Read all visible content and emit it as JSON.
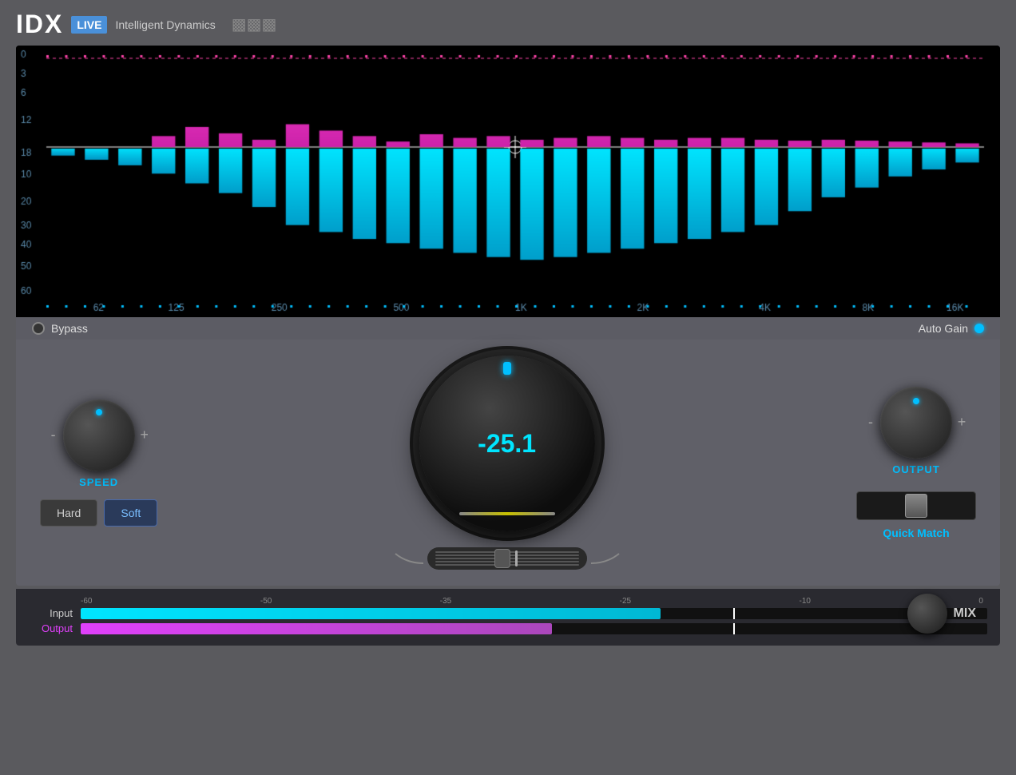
{
  "header": {
    "logo": "IDX",
    "live_badge": "LIVE",
    "subtitle": "Intelligent Dynamics",
    "bars_icon": "||||''"
  },
  "bypass": {
    "label": "Bypass"
  },
  "autogain": {
    "label": "Auto Gain"
  },
  "speed_knob": {
    "label": "SPEED",
    "minus": "-",
    "plus": "+"
  },
  "center_knob": {
    "value": "-25.1"
  },
  "output_knob": {
    "label": "OUTPUT",
    "minus": "-",
    "plus": "+"
  },
  "presets": {
    "hard_label": "Hard",
    "soft_label": "Soft"
  },
  "quick_match": {
    "label": "Quick Match"
  },
  "meters": {
    "input_label": "Input",
    "output_label": "Output",
    "scale": [
      "-60",
      "-50",
      "-35",
      "-25",
      "-10",
      "0"
    ],
    "input_fill_percent": 64,
    "output_fill_percent": 52
  },
  "mix": {
    "label": "MIX"
  },
  "spectrum": {
    "left_labels": [
      "0",
      "3",
      "6",
      "12",
      "18",
      "10",
      "20",
      "30",
      "40",
      "50",
      "60"
    ],
    "bottom_labels": [
      "62",
      "125",
      "250",
      "500",
      "1K",
      "2K",
      "4K",
      "8K",
      "16K"
    ]
  }
}
